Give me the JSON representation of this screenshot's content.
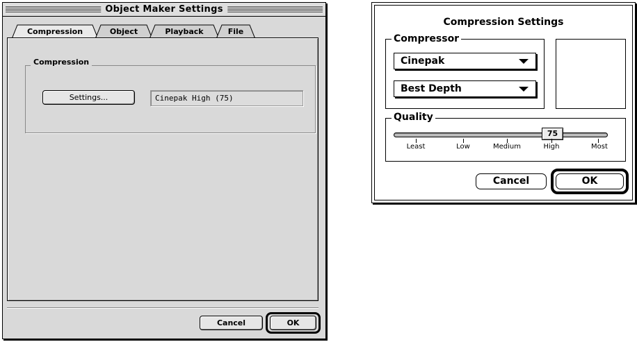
{
  "object_maker": {
    "title": "Object Maker Settings",
    "tabs": [
      {
        "label": "Compression",
        "active": true
      },
      {
        "label": "Object",
        "active": false
      },
      {
        "label": "Playback",
        "active": false
      },
      {
        "label": "File",
        "active": false
      }
    ],
    "compression_group": {
      "label": "Compression",
      "settings_button": "Settings...",
      "current_value": "Cinepak High (75)"
    },
    "cancel_label": "Cancel",
    "ok_label": "OK"
  },
  "compression_settings": {
    "title": "Compression Settings",
    "compressor": {
      "label": "Compressor",
      "codec": "Cinepak",
      "depth": "Best Depth"
    },
    "quality": {
      "label": "Quality",
      "value": "75",
      "ticks": [
        "Least",
        "Low",
        "Medium",
        "High",
        "Most"
      ]
    },
    "cancel_label": "Cancel",
    "ok_label": "OK"
  }
}
